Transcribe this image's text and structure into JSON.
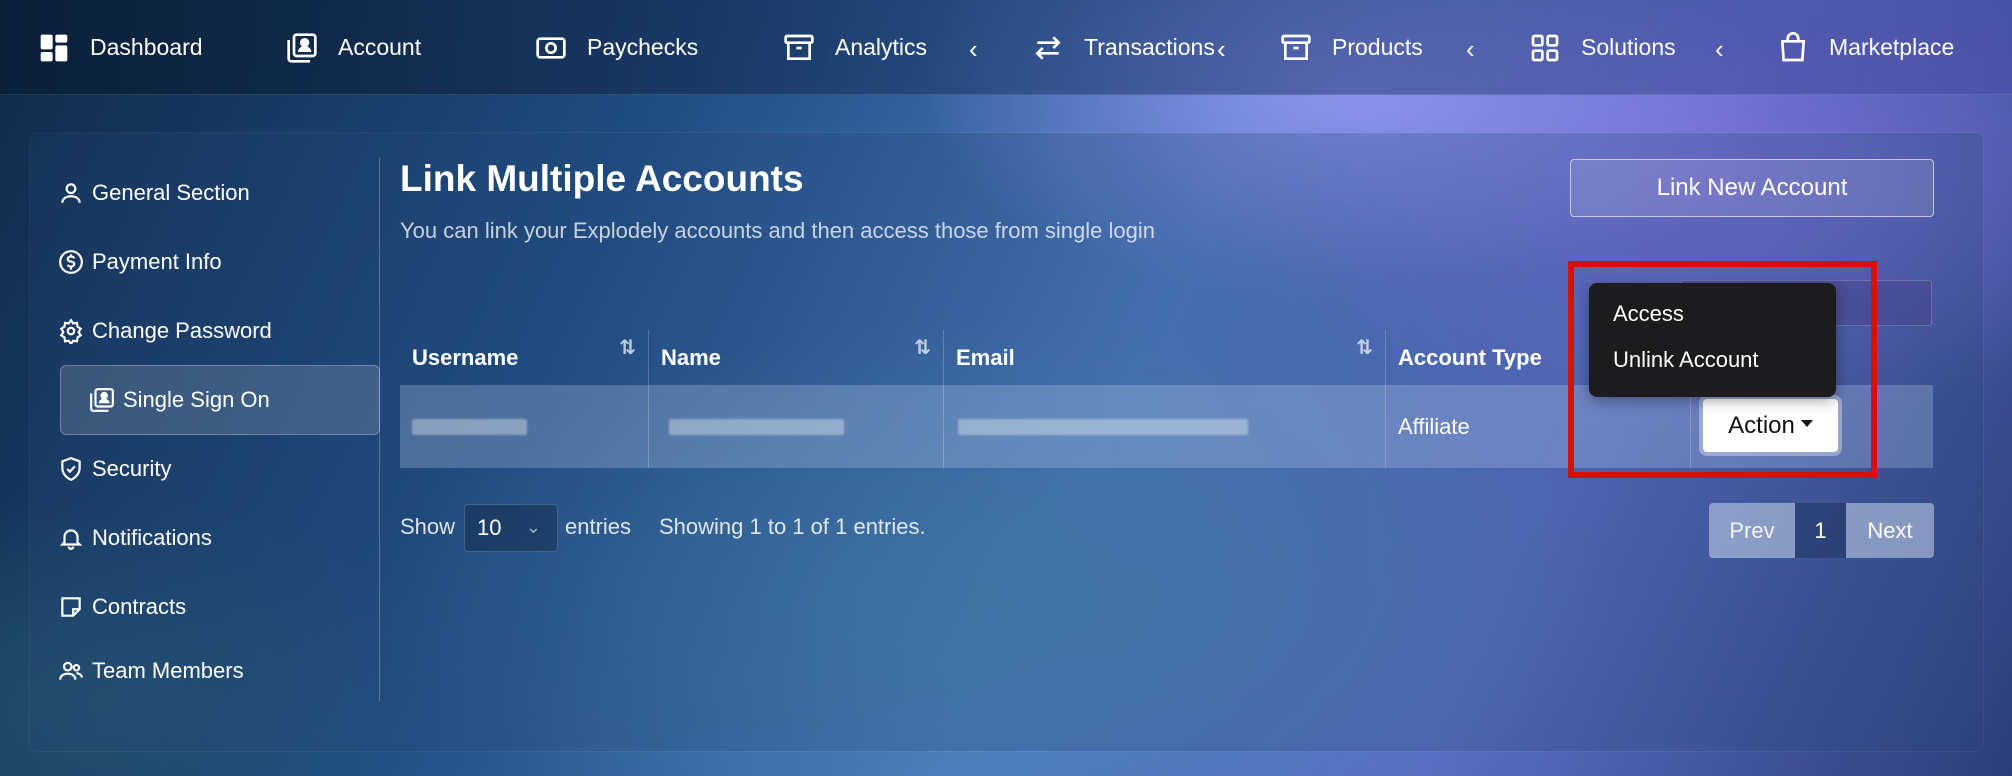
{
  "nav": {
    "items": [
      {
        "label": "Dashboard",
        "icon": "dashboard-icon"
      },
      {
        "label": "Account",
        "icon": "account-icon"
      },
      {
        "label": "Paychecks",
        "icon": "paychecks-icon"
      },
      {
        "label": "Analytics",
        "icon": "archive-icon"
      },
      {
        "label": "Transactions",
        "icon": "transfer-icon"
      },
      {
        "label": "Products",
        "icon": "archive-icon"
      },
      {
        "label": "Solutions",
        "icon": "grid-icon"
      },
      {
        "label": "Marketplace",
        "icon": "bag-icon"
      }
    ],
    "chevron": "‹"
  },
  "sidebar": {
    "items": [
      {
        "label": "General Section",
        "icon": "person-icon"
      },
      {
        "label": "Payment Info",
        "icon": "dollar-circle-icon"
      },
      {
        "label": "Change Password",
        "icon": "gear-icon"
      },
      {
        "label": "Single Sign On",
        "icon": "account-card-icon",
        "active": true
      },
      {
        "label": "Security",
        "icon": "shield-icon"
      },
      {
        "label": "Notifications",
        "icon": "bell-icon"
      },
      {
        "label": "Contracts",
        "icon": "note-icon"
      },
      {
        "label": "Team Members",
        "icon": "team-icon"
      }
    ]
  },
  "main": {
    "title": "Link Multiple Accounts",
    "subtitle": "You can link your Explodely accounts and then access those from single login",
    "link_button": "Link New Account"
  },
  "table": {
    "columns": [
      "Username",
      "Name",
      "Email",
      "Account Type"
    ],
    "sort_icon": "⇅",
    "row": {
      "account_type": "Affiliate",
      "action_label": "Action"
    }
  },
  "dropdown": {
    "items": [
      "Access",
      "Unlink Account"
    ]
  },
  "footer": {
    "show_label": "Show",
    "entries_value": "10",
    "entries_label": "entries",
    "showing_text": "Showing 1 to 1 of 1 entries.",
    "prev": "Prev",
    "page": "1",
    "next": "Next"
  },
  "colors": {
    "highlight": "#d90d12",
    "dropdown_bg": "#1c1c1e"
  }
}
